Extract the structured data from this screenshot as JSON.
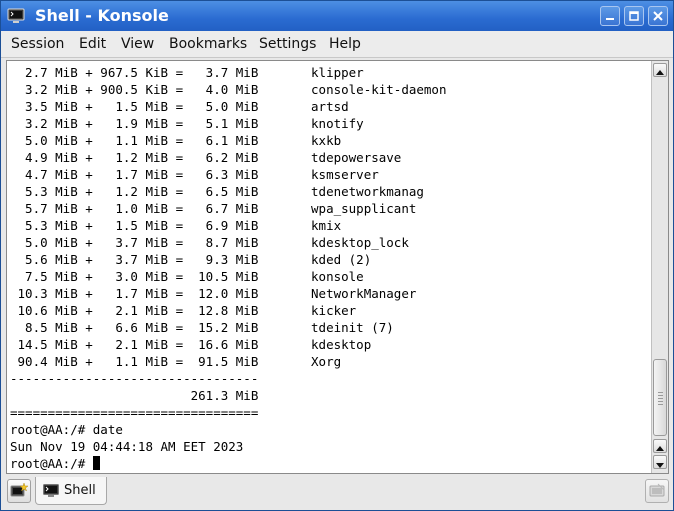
{
  "window": {
    "title": "Shell - Konsole",
    "title_icon": "konsole-app-icon",
    "controls": [
      "minimize-icon",
      "maximize-icon",
      "close-icon"
    ]
  },
  "colors": {
    "titlebar": "#2a6bd1",
    "terminal_bg": "#ffffff",
    "terminal_fg": "#000000"
  },
  "menu": {
    "items": [
      "Session",
      "Edit",
      "View",
      "Bookmarks",
      "Settings",
      "Help"
    ]
  },
  "terminal": {
    "lines": [
      "  2.7 MiB + 967.5 KiB =   3.7 MiB       klipper",
      "  3.2 MiB + 900.5 KiB =   4.0 MiB       console-kit-daemon",
      "  3.5 MiB +   1.5 MiB =   5.0 MiB       artsd",
      "  3.2 MiB +   1.9 MiB =   5.1 MiB       knotify",
      "  5.0 MiB +   1.1 MiB =   6.1 MiB       kxkb",
      "  4.9 MiB +   1.2 MiB =   6.2 MiB       tdepowersave",
      "  4.7 MiB +   1.7 MiB =   6.3 MiB       ksmserver",
      "  5.3 MiB +   1.2 MiB =   6.5 MiB       tdenetworkmanag",
      "  5.7 MiB +   1.0 MiB =   6.7 MiB       wpa_supplicant",
      "  5.3 MiB +   1.5 MiB =   6.9 MiB       kmix",
      "  5.0 MiB +   3.7 MiB =   8.7 MiB       kdesktop_lock",
      "  5.6 MiB +   3.7 MiB =   9.3 MiB       kded (2)",
      "  7.5 MiB +   3.0 MiB =  10.5 MiB       konsole",
      " 10.3 MiB +   1.7 MiB =  12.0 MiB       NetworkManager",
      " 10.6 MiB +   2.1 MiB =  12.8 MiB       kicker",
      "  8.5 MiB +   6.6 MiB =  15.2 MiB       tdeinit (7)",
      " 14.5 MiB +   2.1 MiB =  16.6 MiB       kdesktop",
      " 90.4 MiB +   1.1 MiB =  91.5 MiB       Xorg",
      "---------------------------------",
      "                        261.3 MiB",
      "=================================",
      "root@AA:/# date",
      "Sun Nov 19 04:44:18 AM EET 2023"
    ],
    "prompt": "root@AA:/# "
  },
  "tabs": {
    "new_tab_icon": "new-tab-icon",
    "close_tab_icon": "close-tab-icon",
    "items": [
      {
        "label": "Shell",
        "icon": "terminal-icon"
      }
    ]
  }
}
